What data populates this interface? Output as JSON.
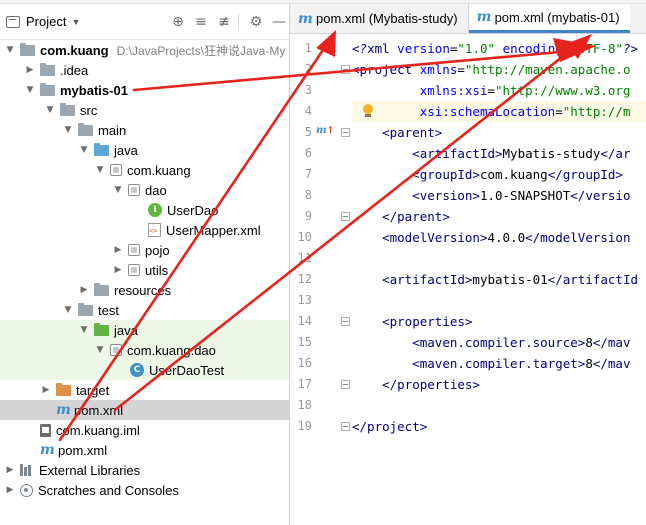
{
  "project_panel": {
    "title": "Project",
    "tools": {
      "locate": "⊕",
      "expand": "≡",
      "collapse": "≢",
      "settings": "⚙",
      "hide": "—"
    },
    "tree": [
      {
        "label": "com.kuang",
        "path": "D:\\JavaProjects\\狂神说Java-My",
        "bold": true
      },
      {
        "label": ".idea"
      },
      {
        "label": "mybatis-01",
        "bold": true
      },
      {
        "label": "src"
      },
      {
        "label": "main"
      },
      {
        "label": "java"
      },
      {
        "label": "com.kuang"
      },
      {
        "label": "dao"
      },
      {
        "label": "UserDao"
      },
      {
        "label": "UserMapper.xml"
      },
      {
        "label": "pojo"
      },
      {
        "label": "utils"
      },
      {
        "label": "resources"
      },
      {
        "label": "test"
      },
      {
        "label": "java"
      },
      {
        "label": "com.kuang.dao"
      },
      {
        "label": "UserDaoTest"
      },
      {
        "label": "target"
      },
      {
        "label": "pom.xml"
      },
      {
        "label": "com.kuang.iml"
      },
      {
        "label": "pom.xml"
      },
      {
        "label": "External Libraries"
      },
      {
        "label": "Scratches and Consoles"
      }
    ]
  },
  "editor": {
    "tabs": [
      {
        "label": "pom.xml (Mybatis-study)",
        "active": false
      },
      {
        "label": "pom.xml (mybatis-01)",
        "active": true
      }
    ],
    "line_numbers": [
      "1",
      "2",
      "3",
      "4",
      "5",
      "6",
      "7",
      "8",
      "9",
      "10",
      "11",
      "12",
      "13",
      "14",
      "15",
      "16",
      "17",
      "18",
      "19"
    ],
    "lines": [
      {
        "parts": [
          {
            "c": "t-pi",
            "t": "<?"
          },
          {
            "c": "t-tag",
            "t": "xml "
          },
          {
            "c": "t-attr",
            "t": "version"
          },
          {
            "c": "t-txt",
            "t": "="
          },
          {
            "c": "t-val",
            "t": "\"1.0\""
          },
          {
            "c": "t-txt",
            "t": " "
          },
          {
            "c": "t-attr",
            "t": "encoding"
          },
          {
            "c": "t-txt",
            "t": "="
          },
          {
            "c": "t-val",
            "t": "\"UTF-8\""
          },
          {
            "c": "t-pi",
            "t": "?>"
          }
        ]
      },
      {
        "parts": [
          {
            "c": "t-tag",
            "t": "<project "
          },
          {
            "c": "t-attr",
            "t": "xmlns"
          },
          {
            "c": "t-txt",
            "t": "="
          },
          {
            "c": "t-val",
            "t": "\"http://maven.apache.o"
          }
        ]
      },
      {
        "parts": [
          {
            "c": "t-txt",
            "t": "         "
          },
          {
            "c": "t-attr",
            "t": "xmlns:xsi"
          },
          {
            "c": "t-txt",
            "t": "="
          },
          {
            "c": "t-val",
            "t": "\"http://www.w3.org"
          }
        ]
      },
      {
        "parts": [
          {
            "c": "t-txt",
            "t": "         "
          },
          {
            "c": "t-attr",
            "t": "xsi:schemaLocation"
          },
          {
            "c": "t-txt",
            "t": "="
          },
          {
            "c": "t-val",
            "t": "\"http://m"
          }
        ]
      },
      {
        "parts": [
          {
            "c": "t-txt",
            "t": "    "
          },
          {
            "c": "t-tag",
            "t": "<parent>"
          }
        ]
      },
      {
        "parts": [
          {
            "c": "t-txt",
            "t": "        "
          },
          {
            "c": "t-tag",
            "t": "<artifactId>"
          },
          {
            "c": "t-txt",
            "t": "Mybatis-study"
          },
          {
            "c": "t-tag",
            "t": "</ar"
          }
        ]
      },
      {
        "parts": [
          {
            "c": "t-txt",
            "t": "        "
          },
          {
            "c": "t-tag",
            "t": "<groupId>"
          },
          {
            "c": "t-txt",
            "t": "com.kuang"
          },
          {
            "c": "t-tag",
            "t": "</groupId>"
          }
        ]
      },
      {
        "parts": [
          {
            "c": "t-txt",
            "t": "        "
          },
          {
            "c": "t-tag",
            "t": "<version>"
          },
          {
            "c": "t-txt",
            "t": "1.0-SNAPSHOT"
          },
          {
            "c": "t-tag",
            "t": "</versio"
          }
        ]
      },
      {
        "parts": [
          {
            "c": "t-txt",
            "t": "    "
          },
          {
            "c": "t-tag",
            "t": "</parent>"
          }
        ]
      },
      {
        "parts": [
          {
            "c": "t-txt",
            "t": "    "
          },
          {
            "c": "t-tag",
            "t": "<modelVersion>"
          },
          {
            "c": "t-txt",
            "t": "4.0.0"
          },
          {
            "c": "t-tag",
            "t": "</modelVersion"
          }
        ]
      },
      {
        "parts": []
      },
      {
        "parts": [
          {
            "c": "t-txt",
            "t": "    "
          },
          {
            "c": "t-tag",
            "t": "<artifactId>"
          },
          {
            "c": "t-txt",
            "t": "mybatis-01"
          },
          {
            "c": "t-tag",
            "t": "</artifactId"
          }
        ]
      },
      {
        "parts": []
      },
      {
        "parts": [
          {
            "c": "t-txt",
            "t": "    "
          },
          {
            "c": "t-tag",
            "t": "<properties>"
          }
        ]
      },
      {
        "parts": [
          {
            "c": "t-txt",
            "t": "        "
          },
          {
            "c": "t-tag",
            "t": "<maven.compiler.source>"
          },
          {
            "c": "t-txt",
            "t": "8"
          },
          {
            "c": "t-tag",
            "t": "</mav"
          }
        ]
      },
      {
        "parts": [
          {
            "c": "t-txt",
            "t": "        "
          },
          {
            "c": "t-tag",
            "t": "<maven.compiler.target>"
          },
          {
            "c": "t-txt",
            "t": "8"
          },
          {
            "c": "t-tag",
            "t": "</mav"
          }
        ]
      },
      {
        "parts": [
          {
            "c": "t-txt",
            "t": "    "
          },
          {
            "c": "t-tag",
            "t": "</properties>"
          }
        ]
      },
      {
        "parts": []
      },
      {
        "parts": [
          {
            "c": "t-tag",
            "t": "</project>"
          }
        ]
      }
    ]
  },
  "colors": {
    "annotation_red": "#e8231d",
    "selection_grey": "#d5d5d5",
    "test_green_bg": "#eef8e6",
    "active_tab_underline": "#4083c9"
  }
}
